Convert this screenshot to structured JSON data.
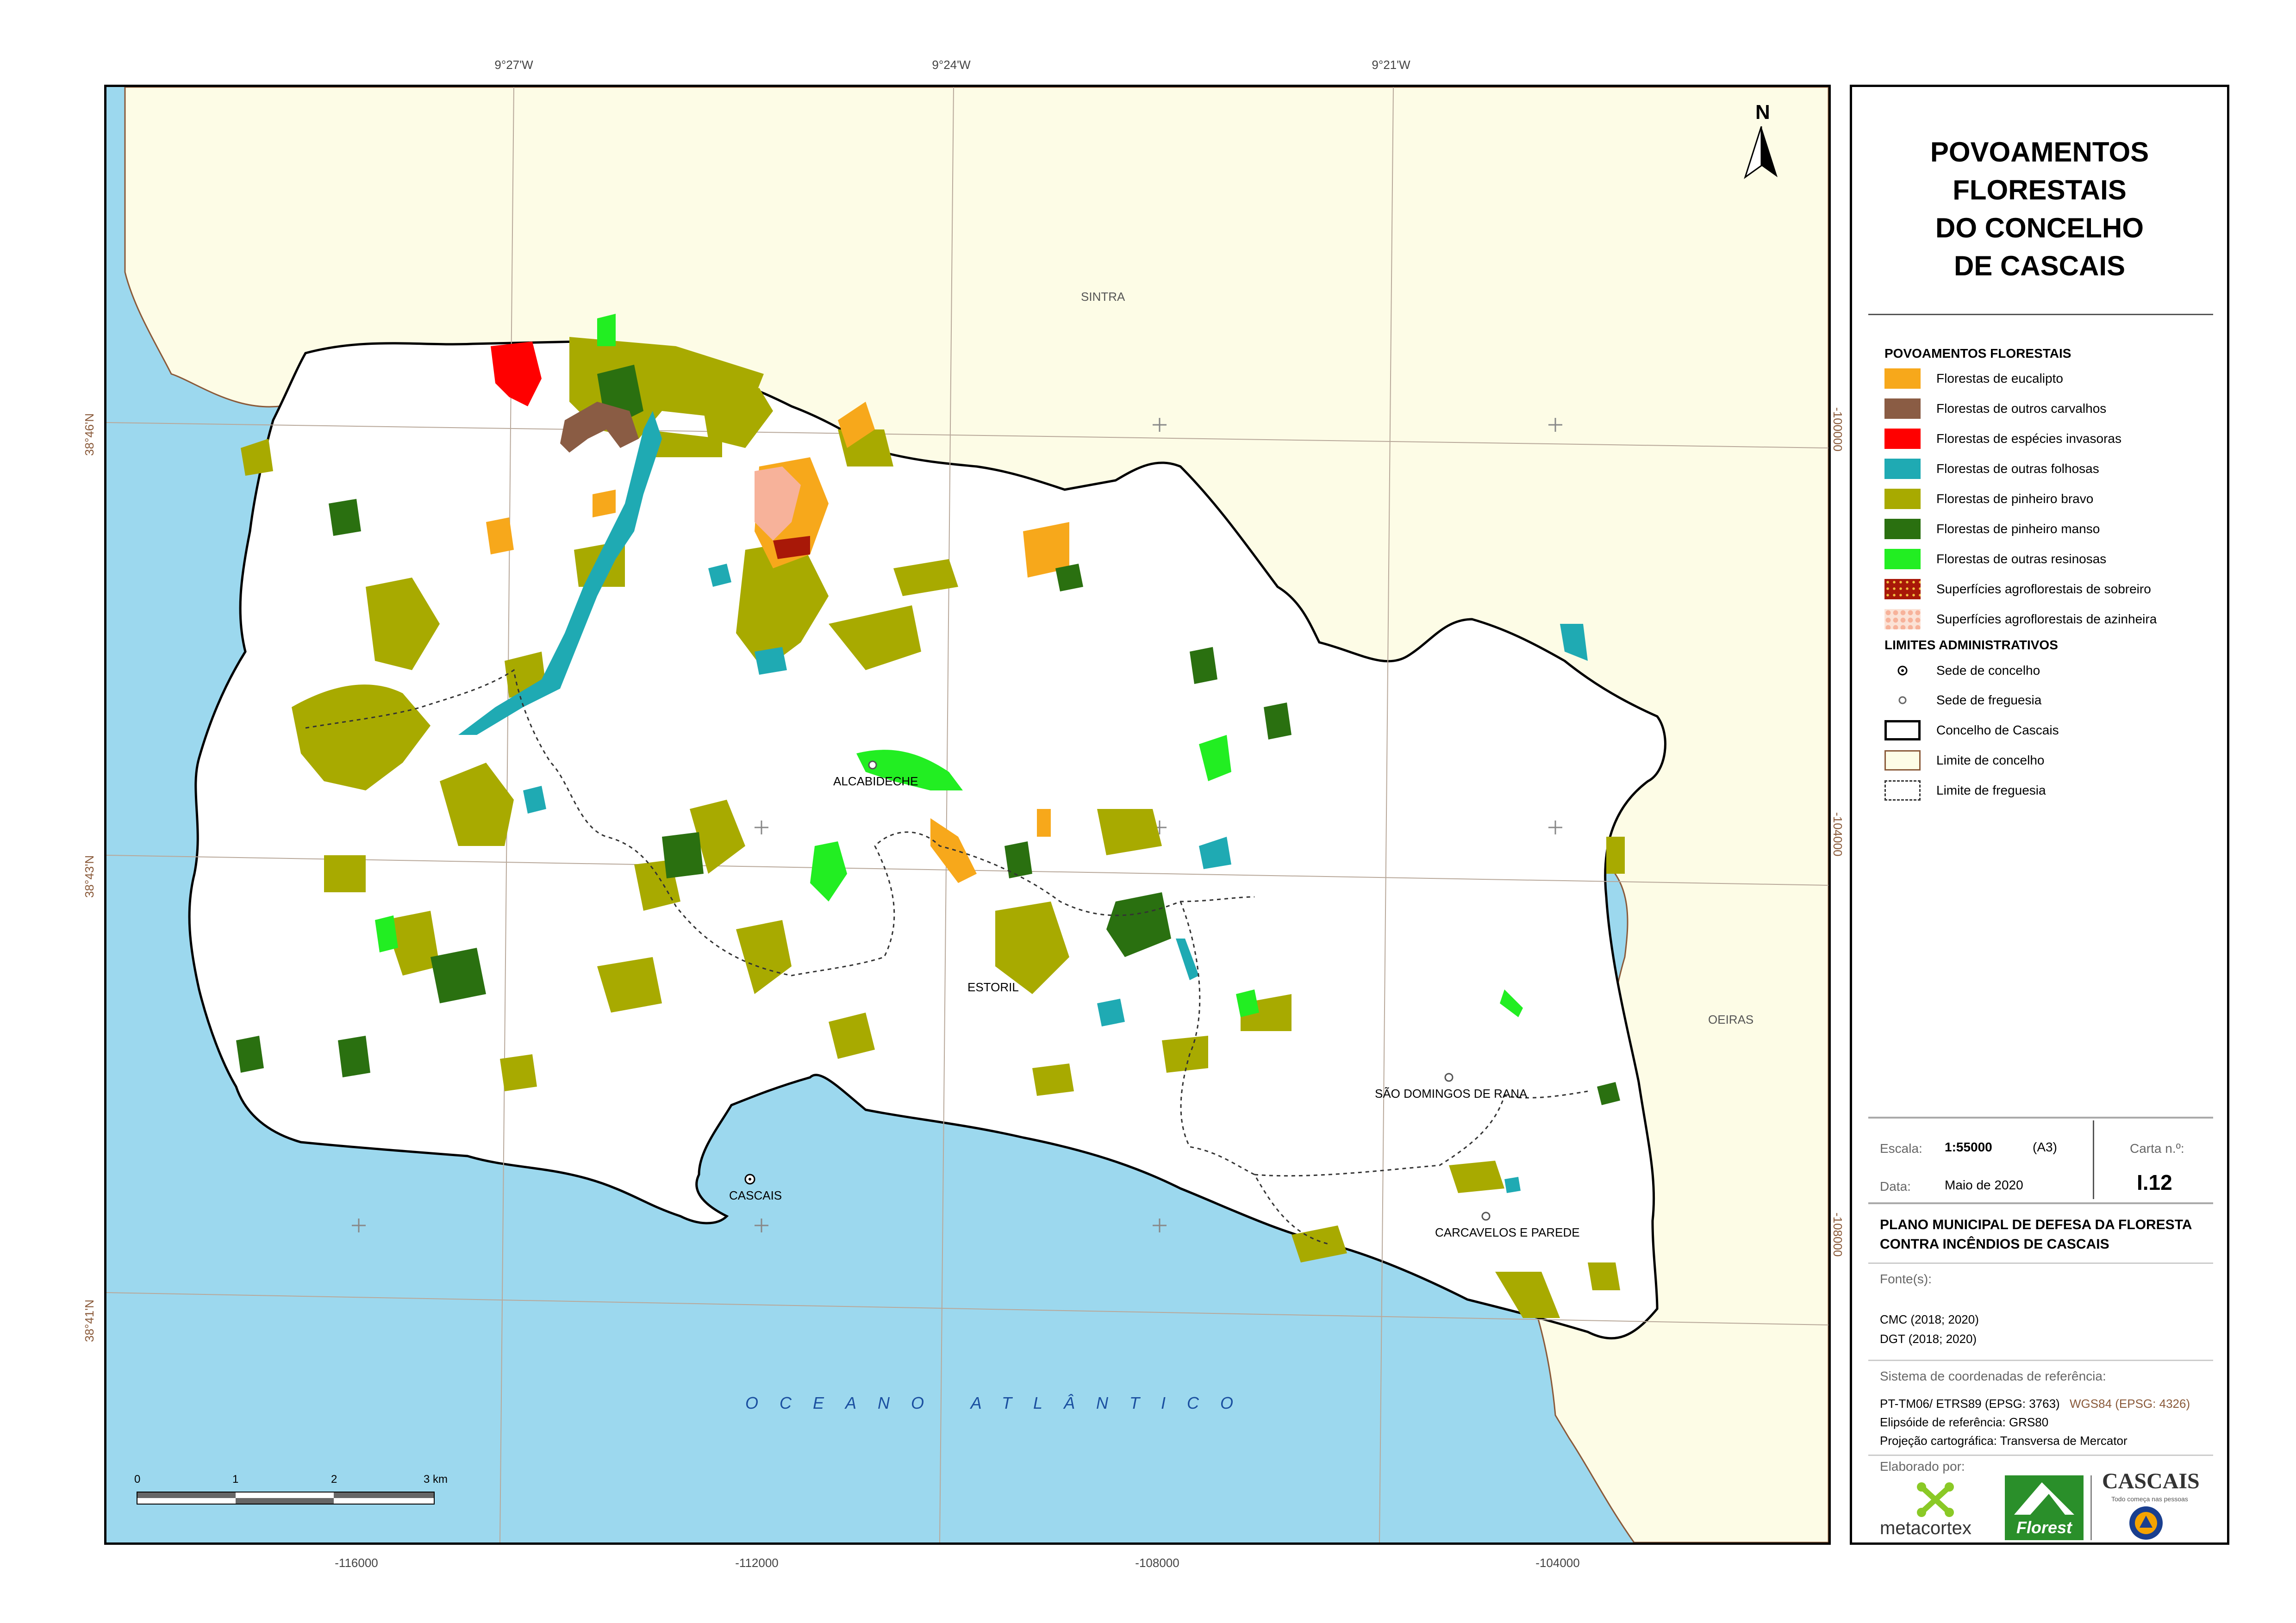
{
  "map": {
    "colors": {
      "sea": "#9cd8ee",
      "neighbor": "#fdfce6",
      "municipality": "#ffffff",
      "eucalipto": "#f7a81b",
      "carvalhos": "#8a5c44",
      "invasoras": "#ff0000",
      "folhosas": "#1faab3",
      "pinheiro_bravo": "#a8aa00",
      "pinheiro_manso": "#2a7010",
      "resinosas": "#22ee22",
      "sobreiro": "#a81808",
      "azinheira": "#f7b29a"
    },
    "north_arrow": "N",
    "top_coords": [
      "9°27'W",
      "9°24'W",
      "9°21'W"
    ],
    "bottom_coords": [
      "-116000",
      "-112000",
      "-108000",
      "-104000"
    ],
    "left_coords": [
      "38°46'N",
      "38°43'N",
      "38°41'N"
    ],
    "right_coords": [
      "-100000",
      "-104000",
      "-108000"
    ],
    "places": {
      "sintra": "SINTRA",
      "oeiras": "OEIRAS",
      "alcabideche": "ALCABIDECHE",
      "estoril": "ESTORIL",
      "cascais": "CASCAIS",
      "sao_domingos": "SÃO DOMINGOS DE RANA",
      "carcavelos": "CARCAVELOS E PAREDE",
      "ocean": "OCEANO ATLÂNTICO"
    },
    "scale_ticks": [
      "0",
      "1",
      "2",
      "3 km"
    ]
  },
  "panel": {
    "title": [
      "POVOAMENTOS",
      "FLORESTAIS",
      "DO CONCELHO",
      "DE CASCAIS"
    ],
    "legend_forest_title": "POVOAMENTOS FLORESTAIS",
    "legend_forest": [
      {
        "label": "Florestas de eucalipto",
        "color": "#f7a81b"
      },
      {
        "label": "Florestas de outros carvalhos",
        "color": "#8a5c44"
      },
      {
        "label": "Florestas de espécies invasoras",
        "color": "#ff0000"
      },
      {
        "label": "Florestas de outras folhosas",
        "color": "#1faab3"
      },
      {
        "label": "Florestas de pinheiro bravo",
        "color": "#a8aa00"
      },
      {
        "label": "Florestas de pinheiro manso",
        "color": "#2a7010"
      },
      {
        "label": "Florestas de outras resinosas",
        "color": "#22ee22"
      },
      {
        "label": "Superfícies agroflorestais de sobreiro",
        "color": "#a81808"
      },
      {
        "label": "Superfícies agroflorestais de azinheira",
        "color": "#f7b29a"
      }
    ],
    "legend_admin_title": "LIMITES ADMINISTRATIVOS",
    "legend_admin": [
      {
        "label": "Sede de concelho"
      },
      {
        "label": "Sede de freguesia"
      },
      {
        "label": "Concelho de Cascais"
      },
      {
        "label": "Limite de concelho"
      },
      {
        "label": "Limite de freguesia"
      }
    ],
    "scale_label": "Escala:",
    "scale_value": "1:55000",
    "paper": "(A3)",
    "sheet_label": "Carta n.º:",
    "sheet_value": "I.12",
    "date_label": "Data:",
    "date_value": "Maio de 2020",
    "plan_title": "PLANO MUNICIPAL DE DEFESA DA FLORESTA CONTRA INCÊNDIOS DE CASCAIS",
    "sources_label": "Fonte(s):",
    "sources": [
      "CMC (2018; 2020)",
      "DGT (2018; 2020)"
    ],
    "crs_label": "Sistema de coordenadas de referência:",
    "crs_main": "PT-TM06/ ETRS89 (EPSG: 3763)",
    "crs_alt": "WGS84 (EPSG: 4326)",
    "ellipsoid": "Elipsóide de referência: GRS80",
    "projection": "Projeção cartográfica: Transversa de Mercator",
    "made_by": "Elaborado por:",
    "logo_metacortex": "metacortex",
    "logo_florest": "Florest",
    "logo_cascais": "CASCAIS",
    "logo_cascais_tagline": "Todo começa nas pessoas"
  }
}
